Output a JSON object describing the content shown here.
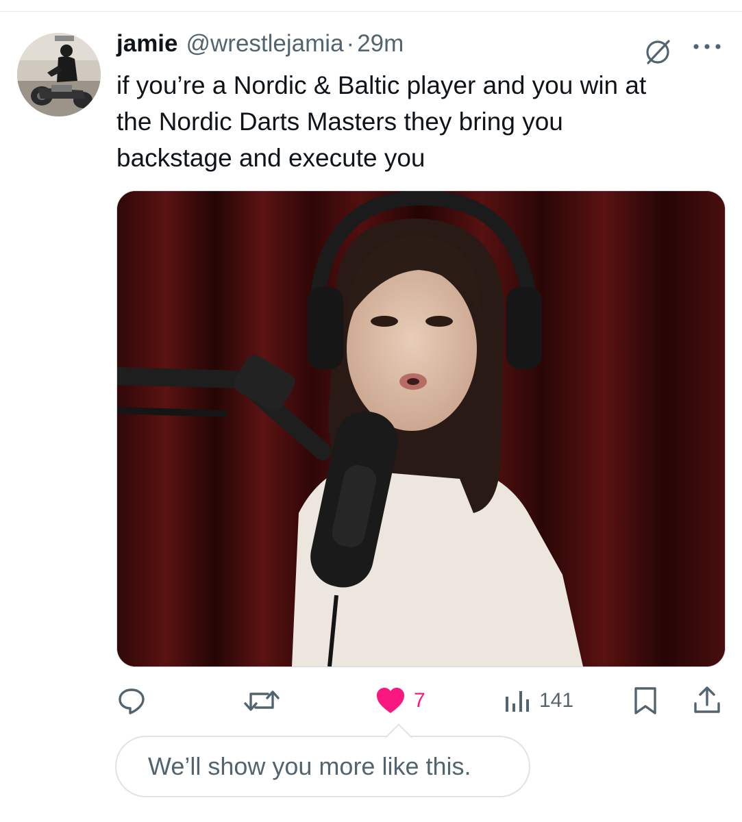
{
  "tweet": {
    "author_name": "jamie",
    "author_handle": "@wrestlejamia",
    "separator": "·",
    "timestamp": "29m",
    "text_lines": [
      "if you’re a Nordic & Baltic player and you win at",
      "the Nordic Darts Masters they bring you",
      "backstage and execute you"
    ],
    "media_alt": "woman in headphones speaking into a podcast microphone in front of a red curtain"
  },
  "actions": {
    "reply_icon": "reply-icon",
    "retweet_icon": "retweet-icon",
    "like_icon": "heart-filled-icon",
    "like_count": "7",
    "views_icon": "views-bar-chart-icon",
    "view_count": "141",
    "bookmark_icon": "bookmark-icon",
    "share_icon": "share-icon"
  },
  "toast": {
    "message": "We’ll show you more like this."
  },
  "colors": {
    "text": "#0f1419",
    "secondary": "#536471",
    "like": "#f91880",
    "divider": "#e6e9ec"
  }
}
